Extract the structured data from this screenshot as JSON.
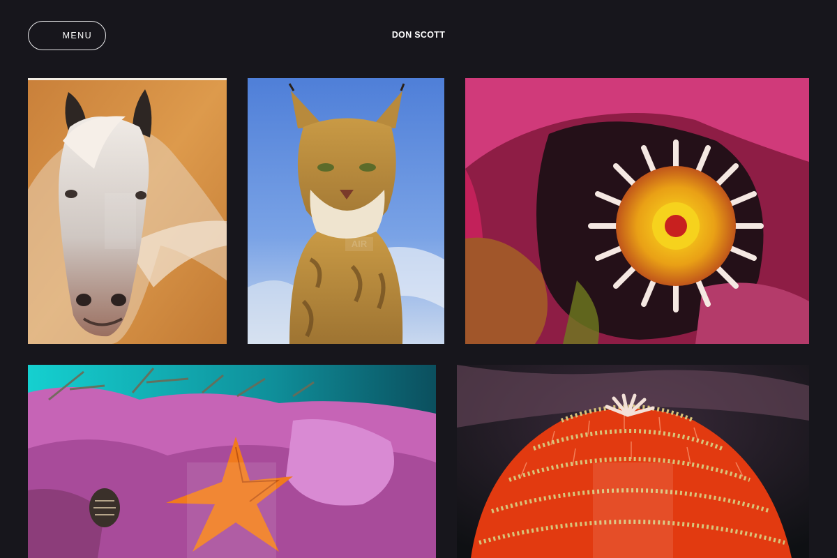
{
  "header": {
    "menu_label": "MENU",
    "site_title": "DON SCOTT"
  },
  "gallery": {
    "items": [
      {
        "subject": "white horse painting",
        "colors": {
          "bg": "#d9903f",
          "accent": "#ece6e0"
        }
      },
      {
        "subject": "lynx painting",
        "colors": {
          "bg": "#5f8fe0",
          "accent": "#b48a3c"
        }
      },
      {
        "subject": "sea anemone photo",
        "colors": {
          "bg": "#b02460",
          "accent": "#f2c51a"
        }
      },
      {
        "subject": "orange starfish photo",
        "colors": {
          "bg": "#15c8c8",
          "accent": "#f07a1e"
        }
      },
      {
        "subject": "red coral photo",
        "colors": {
          "bg": "#121417",
          "accent": "#e23a10"
        }
      }
    ]
  },
  "watermark": {
    "lynx_text": "AIR"
  }
}
